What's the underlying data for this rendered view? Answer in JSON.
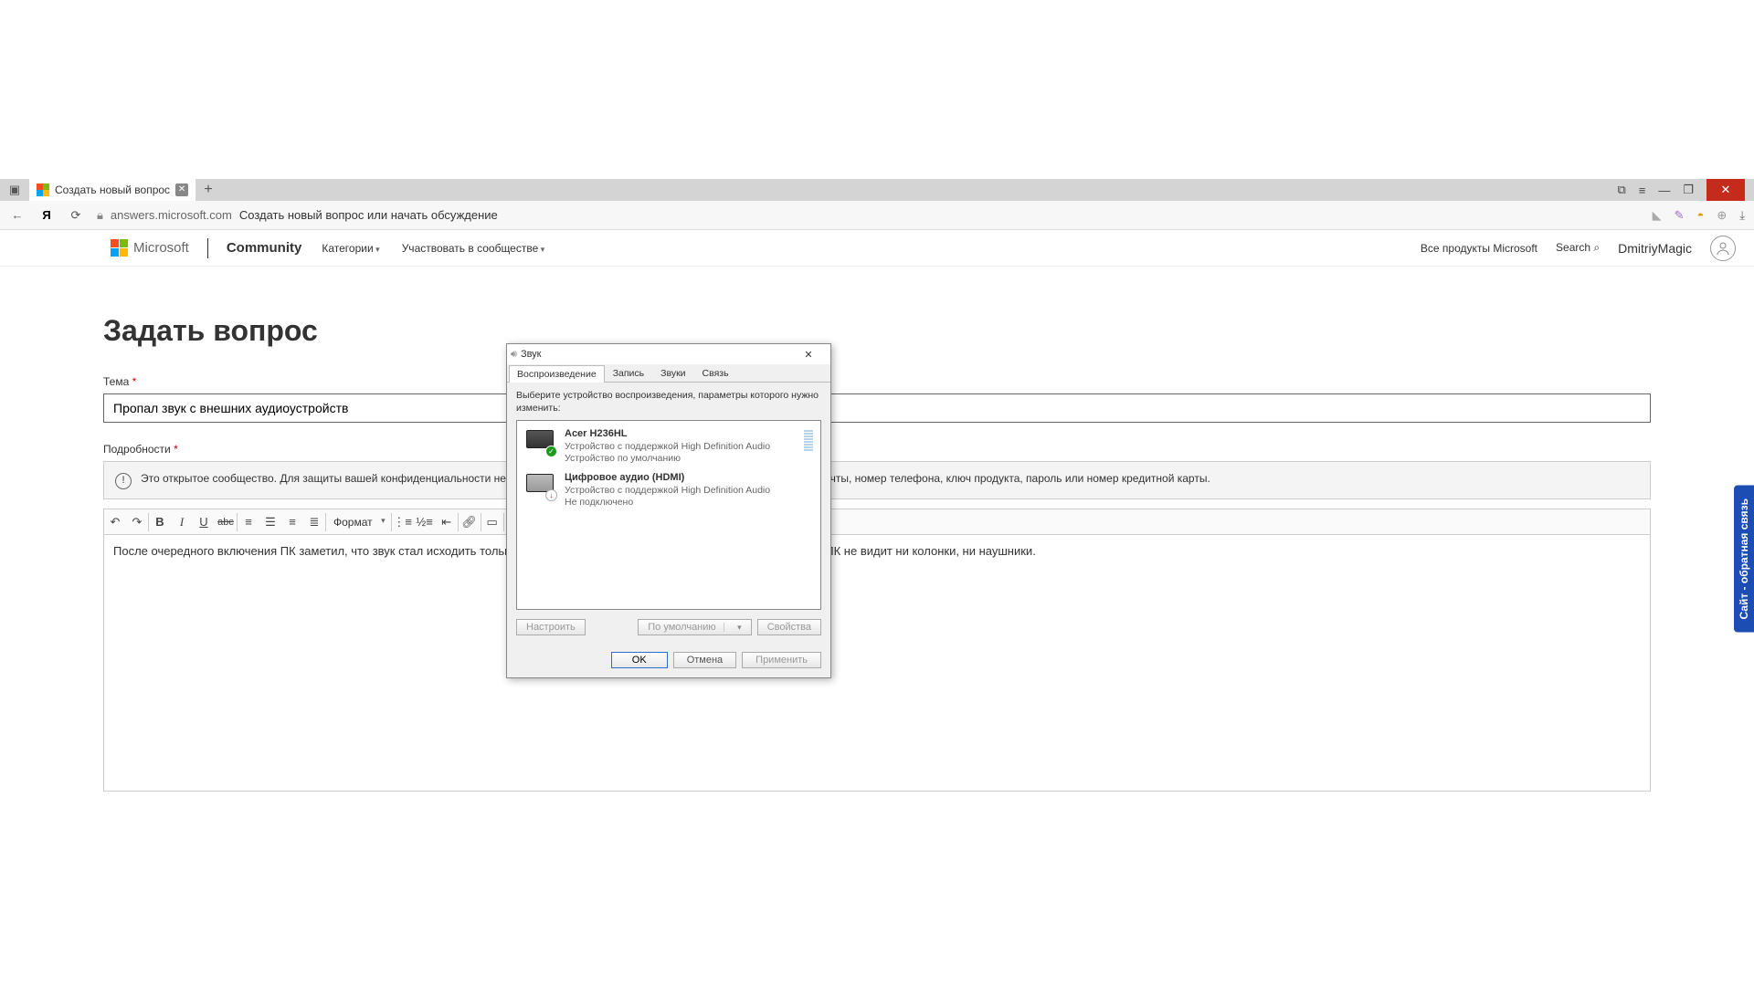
{
  "browser": {
    "tab_title": "Создать новый вопрос",
    "url_domain": "answers.microsoft.com",
    "url_title": "Создать новый вопрос или начать обсуждение"
  },
  "header": {
    "brand": "Microsoft",
    "community": "Community",
    "nav_categories": "Категории",
    "nav_participate": "Участвовать в сообществе",
    "nav_products": "Все продукты Microsoft",
    "search": "Search",
    "username": "DmitriyMagic"
  },
  "page": {
    "title": "Задать вопрос",
    "theme_label": "Тема",
    "theme_value": "Пропал звук с внешних аудиоустройств",
    "details_label": "Подробности",
    "notice": "Это открытое сообщество. Для защиты вашей конфиденциальности не публикуйте личные сведения, например адрес электронной почты, номер телефона, ключ продукта, пароль или номер кредитной карты.",
    "format_label": "Формат",
    "body_text": "После очередного включения ПК заметил, что звук стал исходить только от монитора. Проверив настройки звука оказалось что ПК не видит ни колонки, ни наушники."
  },
  "dialog": {
    "title": "Звук",
    "tabs": {
      "play": "Воспроизведение",
      "rec": "Запись",
      "sounds": "Звуки",
      "comm": "Связь"
    },
    "instruction": "Выберите устройство воспроизведения, параметры которого нужно изменить:",
    "devices": [
      {
        "name": "Acer H236HL",
        "desc": "Устройство с поддержкой High Definition Audio",
        "status": "Устройство по умолчанию",
        "state": "ok"
      },
      {
        "name": "Цифровое аудио (HDMI)",
        "desc": "Устройство с поддержкой High Definition Audio",
        "status": "Не подключено",
        "state": "down"
      }
    ],
    "btn_configure": "Настроить",
    "btn_default": "По умолчанию",
    "btn_properties": "Свойства",
    "btn_ok": "OK",
    "btn_cancel": "Отмена",
    "btn_apply": "Применить"
  },
  "feedback": "Сайт - обратная связь"
}
